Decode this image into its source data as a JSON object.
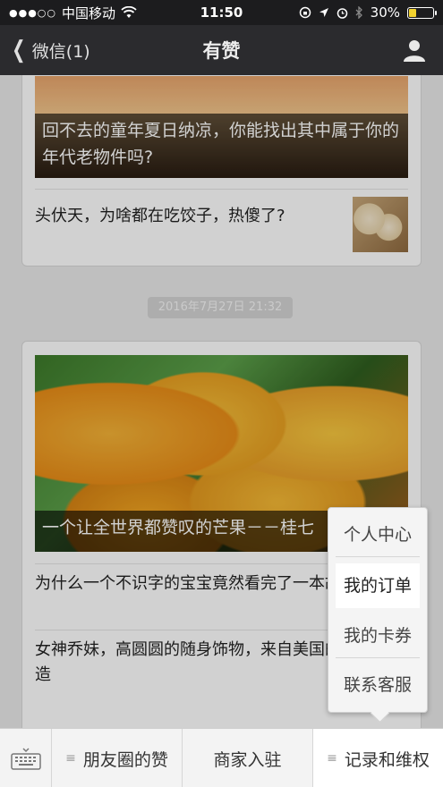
{
  "status_bar": {
    "signal": "●●●○○",
    "carrier": "中国移动",
    "time": "11:50",
    "battery": "30%",
    "battery_level": 0.3
  },
  "nav": {
    "back_label": "微信(1)",
    "title": "有赞"
  },
  "articles_top": {
    "hero_caption": "回不去的童年夏日纳凉，你能找出其中属于你的年代老物件吗?",
    "row_title": "头伏天，为啥都在吃饺子，热傻了?"
  },
  "timestamp": "2016年7月27日 21:32",
  "articles_bottom": {
    "hero_caption": "一个让全世界都赞叹的芒果－－桂七",
    "row1_title": "为什么一个不识字的宝宝竟然看完了一本故事书?",
    "row2_title": "女神乔妹，高圆圆的随身饰物，来自美国的纯手工打造"
  },
  "menu": {
    "tabs": [
      {
        "label": "朋友圈的赞"
      },
      {
        "label": "商家入驻"
      },
      {
        "label": "记录和维权"
      }
    ],
    "submenu": [
      {
        "label": "个人中心"
      },
      {
        "label": "我的订单"
      },
      {
        "label": "我的卡券"
      },
      {
        "label": "联系客服"
      }
    ]
  },
  "colors": {
    "nav_bg": "#2b2b2e",
    "battery_fill": "#f2d22e"
  }
}
